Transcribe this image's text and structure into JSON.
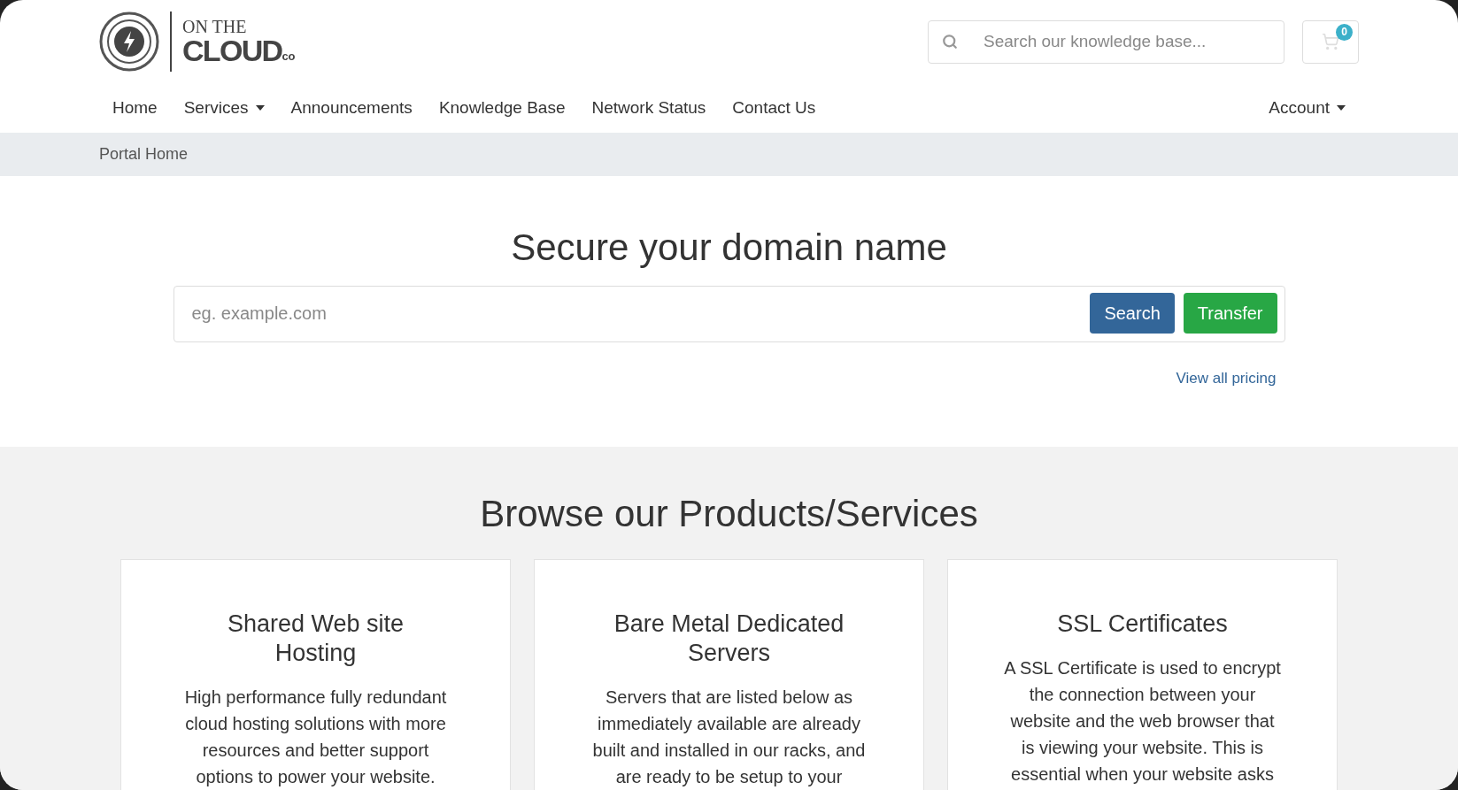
{
  "logo": {
    "line1": "ON THE",
    "line2": "CLOUD",
    "suffix": "co"
  },
  "header_search": {
    "placeholder": "Search our knowledge base..."
  },
  "cart": {
    "count": "0"
  },
  "nav": [
    {
      "label": "Home",
      "dropdown": false
    },
    {
      "label": "Services",
      "dropdown": true
    },
    {
      "label": "Announcements",
      "dropdown": false
    },
    {
      "label": "Knowledge Base",
      "dropdown": false
    },
    {
      "label": "Network Status",
      "dropdown": false
    },
    {
      "label": "Contact Us",
      "dropdown": false
    }
  ],
  "account": {
    "label": "Account",
    "dropdown": true
  },
  "breadcrumb": [
    "Portal Home"
  ],
  "domain": {
    "title": "Secure your domain name",
    "placeholder": "eg. example.com",
    "buttons": [
      {
        "label": "Search",
        "kind": "primary"
      },
      {
        "label": "Transfer",
        "kind": "success"
      }
    ],
    "link": "View all pricing"
  },
  "products": {
    "title": "Browse our Products/Services",
    "cards": [
      {
        "title": "Shared Web site Hosting",
        "text": "High performance fully redundant cloud hosting solutions with more resources and better support options to power your website."
      },
      {
        "title": "Bare Metal Dedicated Servers",
        "text": "Servers that are listed below as immediately available are already built and installed in our racks, and are ready to be setup to your"
      },
      {
        "title": "SSL Certificates",
        "text": "A SSL Certificate is used to encrypt the connection between your website and the web browser that is viewing your website. This is essential when your website asks"
      }
    ]
  }
}
